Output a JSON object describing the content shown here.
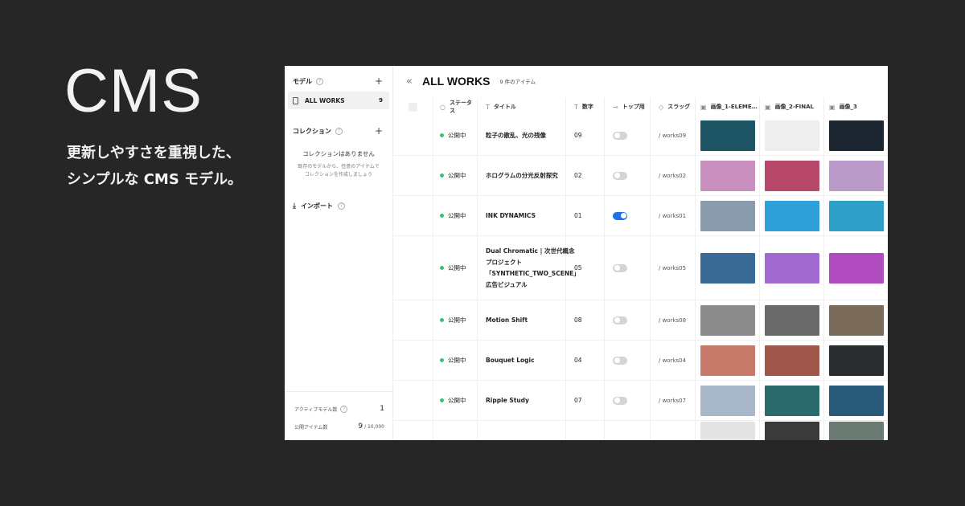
{
  "hero": {
    "title": "CMS",
    "sub_line1": "更新しやすさを重視した、",
    "sub_line2": "シンプルな CMS モデル。"
  },
  "sidebar": {
    "models_label": "モデル",
    "items": [
      {
        "label": "ALL WORKS",
        "count": "9"
      }
    ],
    "collections_label": "コレクション",
    "empty_title": "コレクションはありません",
    "empty_desc_line1": "既存のモデルから、任意のアイテムで",
    "empty_desc_line2": "コレクションを作成しましょう",
    "import_label": "インポート",
    "footer": {
      "active_models_label": "アクティブモデル数",
      "active_models_value": "1",
      "published_items_label": "公開アイテム数",
      "published_items_value": "9",
      "published_items_limit": " / 10,000"
    }
  },
  "main": {
    "title": "ALL WORKS",
    "item_count": "9 件のアイテム",
    "columns": {
      "status": "ステータス",
      "title": "タイトル",
      "number": "数字",
      "top": "トップ用",
      "slug": "スラッグ",
      "img1": "画像_1-ELEME…",
      "img2": "画像_2-FINAL",
      "img3": "画像_3"
    },
    "rows": [
      {
        "status": "公開中",
        "title": "粒子の散乱、光の残像",
        "number": "09",
        "top": false,
        "slug": "/  works09",
        "h": 50,
        "img": [
          "#1d5565",
          "#eeeeee",
          "#1b2630"
        ]
      },
      {
        "status": "公開中",
        "title": "ホログラムの分光反射探究",
        "number": "02",
        "top": false,
        "slug": "/  works02",
        "h": 50,
        "img": [
          "#c98fbf",
          "#b8486a",
          "#b99ac8"
        ]
      },
      {
        "status": "公開中",
        "title": "INK DYNAMICS",
        "number": "01",
        "top": true,
        "slug": "/  works01",
        "h": 50,
        "img": [
          "#8a9bac",
          "#2f9fd8",
          "#2f9fc8"
        ]
      },
      {
        "status": "公開中",
        "title": "Dual Chromatic | 次世代概念プロジェクト「SYNTHETIC_TWO_SCENE」広告ビジュアル",
        "number": "05",
        "top": false,
        "slug": "/  works05",
        "h": 80,
        "img": [
          "#3a6a96",
          "#a06ad0",
          "#b04cc0"
        ]
      },
      {
        "status": "公開中",
        "title": "Motion Shift",
        "number": "08",
        "top": false,
        "slug": "/  works08",
        "h": 50,
        "img": [
          "#8c8c8c",
          "#6a6a6a",
          "#7a6a5a"
        ]
      },
      {
        "status": "公開中",
        "title": "Bouquet Logic",
        "number": "04",
        "top": false,
        "slug": "/  works04",
        "h": 50,
        "img": [
          "#c87a6a",
          "#a0564a",
          "#2a2d2f"
        ]
      },
      {
        "status": "公開中",
        "title": "Ripple Study",
        "number": "07",
        "top": false,
        "slug": "/  works07",
        "h": 50,
        "img": [
          "#a8b8c8",
          "#2a6a6a",
          "#2a5a7a"
        ]
      },
      {
        "status": "",
        "title": "",
        "number": "",
        "top": false,
        "slug": "",
        "h": 40,
        "img": [
          "#e4e4e4",
          "#3a3a3a",
          "#6a7a72"
        ]
      }
    ]
  }
}
